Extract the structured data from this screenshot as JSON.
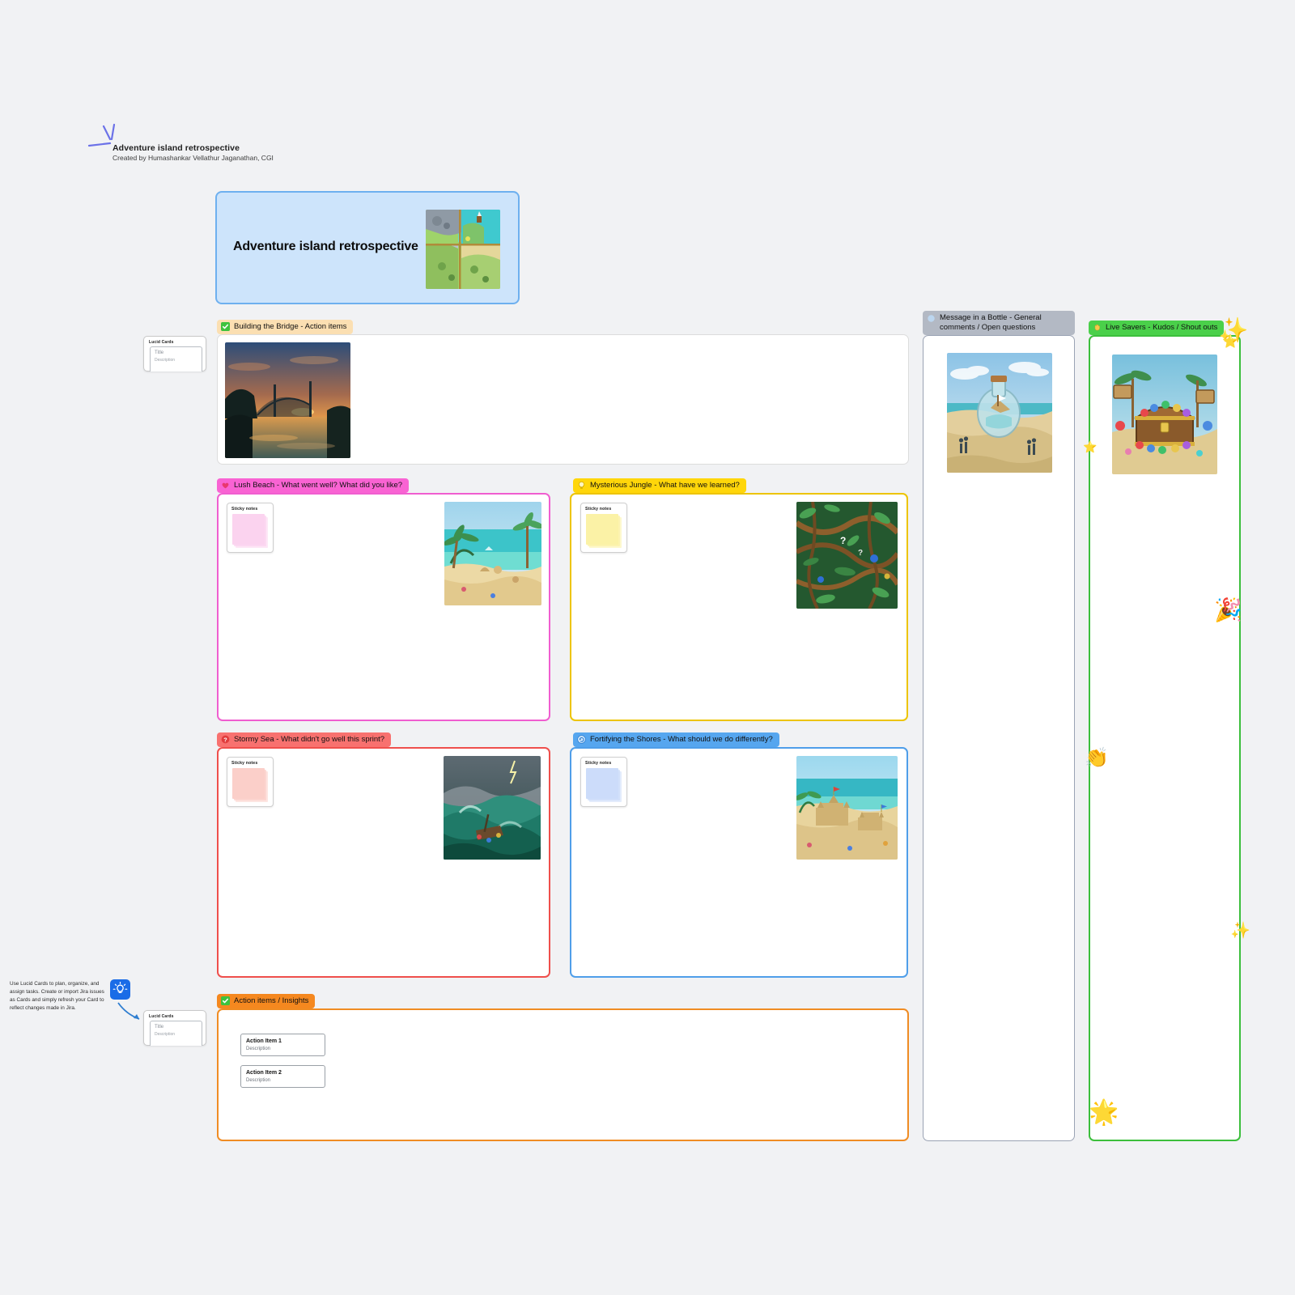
{
  "document": {
    "title": "Adventure island retrospective",
    "subtitle": "Created by Humashankar Vellathur Jaganathan, CGI",
    "logo_icon": "lucid-spark-logo-icon"
  },
  "title_card": {
    "heading": "Adventure island retrospective",
    "image_alt": "adventure-island-map-illustration",
    "bg_color": "#cde4fb",
    "border_color": "#6eb0ef"
  },
  "sections": [
    {
      "id": "building-the-bridge",
      "label": "Building the Bridge - Action items",
      "icon": "green-check-icon",
      "tag_bg": "#fbdfb2",
      "border_color": "#d9d9d9",
      "image_alt": "sunset-bridge-photo"
    },
    {
      "id": "lush-beach",
      "label": "Lush Beach - What went well? What did you like?",
      "icon": "pink-heart-icon",
      "tag_bg": "#f963d3",
      "border_color": "#f05ed0",
      "image_alt": "tropical-beach-illustration",
      "sticky": {
        "label": "Sticky notes",
        "color": "#fbd3ef"
      }
    },
    {
      "id": "mysterious-jungle",
      "label": "Mysterious Jungle -  What have we learned?",
      "icon": "yellow-lightbulb-icon",
      "tag_bg": "#ffd60a",
      "border_color": "#edc400",
      "image_alt": "jungle-vines-illustration",
      "sticky": {
        "label": "Sticky notes",
        "color": "#fbf2a6"
      }
    },
    {
      "id": "stormy-sea",
      "label": "Stormy Sea - What didn't go well this sprint?",
      "icon": "red-question-icon",
      "tag_bg": "#f8716f",
      "border_color": "#ef4f4c",
      "image_alt": "stormy-sea-shipwreck-illustration",
      "sticky": {
        "label": "Sticky notes",
        "color": "#fbcfc9"
      }
    },
    {
      "id": "fortifying-the-shores",
      "label": "Fortifying the Shores - What should we do differently?",
      "icon": "blue-recycle-icon",
      "tag_bg": "#56a6ef",
      "border_color": "#4f9ee9",
      "image_alt": "sandcastle-beach-illustration",
      "sticky": {
        "label": "Sticky notes",
        "color": "#ccdcfa"
      }
    },
    {
      "id": "action-items-insights",
      "label": "Action items / Insights",
      "icon": "green-check-icon",
      "tag_bg": "#f5881f",
      "border_color": "#f08c23"
    }
  ],
  "side_panels": [
    {
      "id": "message-in-a-bottle",
      "label": "Message in a Bottle - General comments / Open questions",
      "icon": "blue-circle-icon",
      "tag_bg": "#b3b9c4",
      "border_color": "#9aa3b4",
      "image_alt": "message-in-a-bottle-illustration"
    },
    {
      "id": "live-savers",
      "label": "Live Savers - Kudos / Shout outs",
      "icon": "yellow-hand-icon",
      "tag_bg": "#4ad04a",
      "border_color": "#3cbf3c",
      "image_alt": "treasure-chest-illustration"
    }
  ],
  "lucid_cards": [
    {
      "widget_title": "Lucid Cards",
      "field_title": "Title",
      "field_description": "Description"
    },
    {
      "widget_title": "Lucid Cards",
      "field_title": "Title",
      "field_description": "Description"
    }
  ],
  "action_items": [
    {
      "title": "Action Item 1",
      "description": "Description"
    },
    {
      "title": "Action Item 2",
      "description": "Description"
    }
  ],
  "tip": {
    "text": "Use Lucid Cards to plan, organize, and assign tasks. Create or import Jira issues as Cards and simply refresh your Card to reflect changes made in Jira.",
    "icon": "lightbulb-icon"
  },
  "decorations": [
    {
      "name": "sparkle-star",
      "glyph": "✨"
    },
    {
      "name": "star",
      "glyph": "⭐"
    },
    {
      "name": "party-popper",
      "glyph": "🎉"
    },
    {
      "name": "clapping-hands",
      "glyph": "👏"
    },
    {
      "name": "sparkles",
      "glyph": "✨"
    },
    {
      "name": "glowing-star",
      "glyph": "🌟"
    }
  ]
}
